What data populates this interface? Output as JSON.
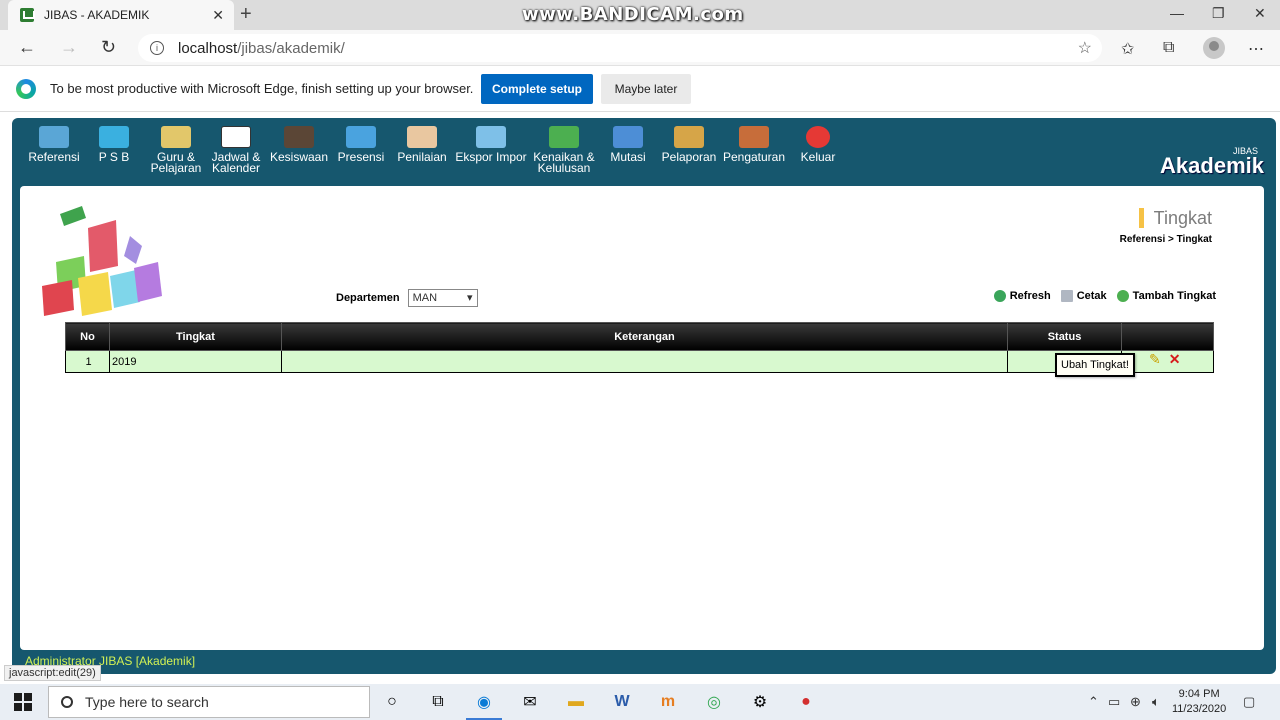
{
  "browser": {
    "tab_title": "JIBAS - AKADEMIK",
    "tab_close": "✕",
    "new_tab": "+",
    "watermark": "www.BANDICAM.com",
    "url_host": "localhost",
    "url_path": "/jibas/akademik/",
    "window_controls": [
      "—",
      "❐",
      "✕"
    ]
  },
  "infobar": {
    "message": "To be most productive with Microsoft Edge, finish setting up your browser.",
    "primary_label": "Complete setup",
    "secondary_label": "Maybe later"
  },
  "menu": {
    "items": [
      {
        "label": "Referensi",
        "icon": "referensi-icon",
        "color": "#5aa6d6"
      },
      {
        "label": "P S B",
        "icon": "psb-icon",
        "color": "#3ab0e0"
      },
      {
        "label": "Guru & Pelajaran",
        "icon": "guru-icon",
        "color": "#e2c76a"
      },
      {
        "label": "Jadwal & Kalender",
        "icon": "calendar-icon",
        "color": "#ffffff"
      },
      {
        "label": "Kesiswaan",
        "icon": "student-icon",
        "color": "#5b4636"
      },
      {
        "label": "Presensi",
        "icon": "presensi-icon",
        "color": "#4aa3df"
      },
      {
        "label": "Penilaian",
        "icon": "penilaian-icon",
        "color": "#e9c7a0"
      },
      {
        "label": "Ekspor Impor",
        "icon": "export-import-icon",
        "color": "#7ec0e8"
      },
      {
        "label": "Kenaikan & Kelulusan",
        "icon": "kenaikan-icon",
        "color": "#4caf50"
      },
      {
        "label": "Mutasi",
        "icon": "mutasi-icon",
        "color": "#4d8ed6"
      },
      {
        "label": "Pelaporan",
        "icon": "pelaporan-icon",
        "color": "#d6a548"
      },
      {
        "label": "Pengaturan",
        "icon": "pengaturan-icon",
        "color": "#c76d3a"
      },
      {
        "label": "Keluar",
        "icon": "keluar-icon",
        "color": "#e53935"
      }
    ],
    "brand_small": "JIBAS",
    "brand_big": "Akademik"
  },
  "page": {
    "title": "Tingkat",
    "breadcrumb": "Referensi >  Tingkat",
    "dept_label": "Departemen",
    "dept_value": "MAN",
    "actions": {
      "refresh": "Refresh",
      "print": "Cetak",
      "add": "Tambah Tingkat"
    }
  },
  "table": {
    "headers": [
      "No",
      "Tingkat",
      "Keterangan",
      "Status",
      ""
    ],
    "rows": [
      {
        "no": "1",
        "tingkat": "2019",
        "keterangan": "",
        "status": ""
      }
    ],
    "tooltip": "Ubah Tingkat!"
  },
  "footer": {
    "user": "Administrator JIBAS [Akademik]",
    "status_tip": "javascript:edit(29)"
  },
  "taskbar": {
    "search_placeholder": "Type here to search",
    "time": "9:04 PM",
    "date": "11/23/2020"
  }
}
